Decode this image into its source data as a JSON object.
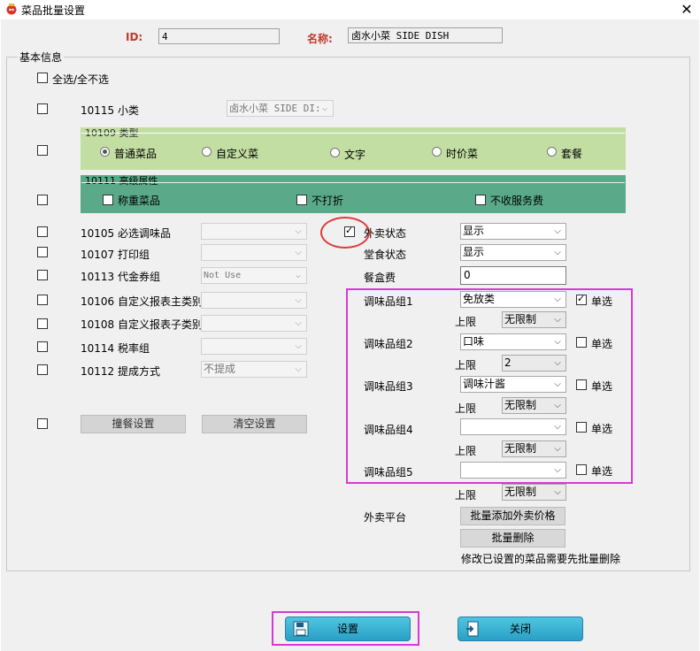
{
  "window": {
    "title": "菜品批量设置",
    "close_glyph": "✕"
  },
  "header": {
    "id_label": "ID:",
    "id_value": "4",
    "name_label": "名称:",
    "name_value": "卤水小菜 SIDE DISH"
  },
  "basic": {
    "group_label": "基本信息",
    "select_all": "全选/全不选"
  },
  "subcategory": {
    "label": "10115 小类",
    "value": "卤水小菜 SIDE DI:"
  },
  "type_group": {
    "label": "10109 类型",
    "options": [
      "普通菜品",
      "自定义菜",
      "文字",
      "时价菜",
      "套餐"
    ],
    "selected": "普通菜品"
  },
  "advanced": {
    "label": "10111 高级属性",
    "options": [
      "称重菜品",
      "不打折",
      "不收服务费"
    ]
  },
  "left_rows": [
    {
      "label": "10105 必选调味品",
      "value": ""
    },
    {
      "label": "10107 打印组",
      "value": ""
    },
    {
      "label": "10113 代金券组",
      "value": "Not Use"
    },
    {
      "label": "10106 自定义报表主类别",
      "value": ""
    },
    {
      "label": "10108 自定义报表子类别",
      "value": ""
    },
    {
      "label": "10114 税率组",
      "value": ""
    },
    {
      "label": "10112 提成方式",
      "value": "不提成"
    }
  ],
  "setmeal": {
    "set_button": "撞餐设置",
    "clear_button": "清空设置"
  },
  "right": {
    "takeout_label": "外卖状态",
    "takeout_value": "显示",
    "dinein_label": "堂食状态",
    "dinein_value": "显示",
    "box_fee_label": "餐盒费",
    "box_fee_value": "0",
    "limit_label": "上限",
    "single_label": "单选",
    "groups": [
      {
        "label": "调味品组1",
        "value": "免放类",
        "single": true,
        "limit": "无限制"
      },
      {
        "label": "调味品组2",
        "value": "口味",
        "single": false,
        "limit": "2"
      },
      {
        "label": "调味品组3",
        "value": "调味汁酱",
        "single": false,
        "limit": "无限制"
      },
      {
        "label": "调味品组4",
        "value": "",
        "single": false,
        "limit": "无限制"
      },
      {
        "label": "调味品组5",
        "value": "",
        "single": false,
        "limit": "无限制"
      }
    ],
    "platform_label": "外卖平台",
    "bulk_add_button": "批量添加外卖价格",
    "bulk_delete_button": "批量删除",
    "note": "修改已设置的菜品需要先批量删除"
  },
  "footer": {
    "set_button": "设置",
    "close_button": "关闭"
  },
  "colors": {
    "highlight_magenta": "#d63ad6",
    "annotation_red": "#e03a3a",
    "green_band": "#c3dea2",
    "teal_band": "#5aaa8a"
  }
}
